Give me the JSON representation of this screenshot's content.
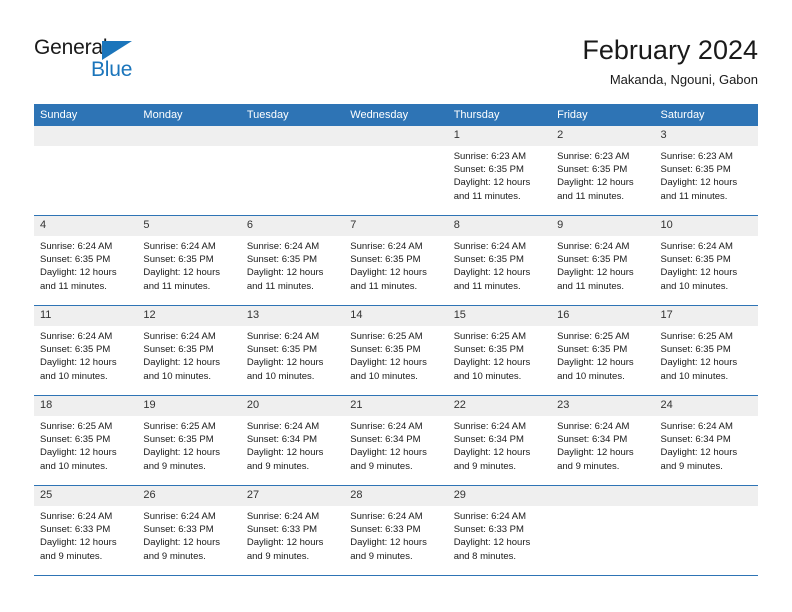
{
  "brand": {
    "name_part1": "General",
    "name_part2": "Blue"
  },
  "header": {
    "title": "February 2024",
    "subtitle": "Makanda, Ngouni, Gabon"
  },
  "colors": {
    "header_blue": "#2e74b5",
    "brand_blue": "#1b75bb",
    "daynum_band": "#efefef",
    "text": "#1a1a1a"
  },
  "weekdays": [
    "Sunday",
    "Monday",
    "Tuesday",
    "Wednesday",
    "Thursday",
    "Friday",
    "Saturday"
  ],
  "weeks": [
    [
      {
        "day": "",
        "sunrise": "",
        "sunset": "",
        "daylight1": "",
        "daylight2": ""
      },
      {
        "day": "",
        "sunrise": "",
        "sunset": "",
        "daylight1": "",
        "daylight2": ""
      },
      {
        "day": "",
        "sunrise": "",
        "sunset": "",
        "daylight1": "",
        "daylight2": ""
      },
      {
        "day": "",
        "sunrise": "",
        "sunset": "",
        "daylight1": "",
        "daylight2": ""
      },
      {
        "day": "1",
        "sunrise": "Sunrise: 6:23 AM",
        "sunset": "Sunset: 6:35 PM",
        "daylight1": "Daylight: 12 hours",
        "daylight2": "and 11 minutes."
      },
      {
        "day": "2",
        "sunrise": "Sunrise: 6:23 AM",
        "sunset": "Sunset: 6:35 PM",
        "daylight1": "Daylight: 12 hours",
        "daylight2": "and 11 minutes."
      },
      {
        "day": "3",
        "sunrise": "Sunrise: 6:23 AM",
        "sunset": "Sunset: 6:35 PM",
        "daylight1": "Daylight: 12 hours",
        "daylight2": "and 11 minutes."
      }
    ],
    [
      {
        "day": "4",
        "sunrise": "Sunrise: 6:24 AM",
        "sunset": "Sunset: 6:35 PM",
        "daylight1": "Daylight: 12 hours",
        "daylight2": "and 11 minutes."
      },
      {
        "day": "5",
        "sunrise": "Sunrise: 6:24 AM",
        "sunset": "Sunset: 6:35 PM",
        "daylight1": "Daylight: 12 hours",
        "daylight2": "and 11 minutes."
      },
      {
        "day": "6",
        "sunrise": "Sunrise: 6:24 AM",
        "sunset": "Sunset: 6:35 PM",
        "daylight1": "Daylight: 12 hours",
        "daylight2": "and 11 minutes."
      },
      {
        "day": "7",
        "sunrise": "Sunrise: 6:24 AM",
        "sunset": "Sunset: 6:35 PM",
        "daylight1": "Daylight: 12 hours",
        "daylight2": "and 11 minutes."
      },
      {
        "day": "8",
        "sunrise": "Sunrise: 6:24 AM",
        "sunset": "Sunset: 6:35 PM",
        "daylight1": "Daylight: 12 hours",
        "daylight2": "and 11 minutes."
      },
      {
        "day": "9",
        "sunrise": "Sunrise: 6:24 AM",
        "sunset": "Sunset: 6:35 PM",
        "daylight1": "Daylight: 12 hours",
        "daylight2": "and 11 minutes."
      },
      {
        "day": "10",
        "sunrise": "Sunrise: 6:24 AM",
        "sunset": "Sunset: 6:35 PM",
        "daylight1": "Daylight: 12 hours",
        "daylight2": "and 10 minutes."
      }
    ],
    [
      {
        "day": "11",
        "sunrise": "Sunrise: 6:24 AM",
        "sunset": "Sunset: 6:35 PM",
        "daylight1": "Daylight: 12 hours",
        "daylight2": "and 10 minutes."
      },
      {
        "day": "12",
        "sunrise": "Sunrise: 6:24 AM",
        "sunset": "Sunset: 6:35 PM",
        "daylight1": "Daylight: 12 hours",
        "daylight2": "and 10 minutes."
      },
      {
        "day": "13",
        "sunrise": "Sunrise: 6:24 AM",
        "sunset": "Sunset: 6:35 PM",
        "daylight1": "Daylight: 12 hours",
        "daylight2": "and 10 minutes."
      },
      {
        "day": "14",
        "sunrise": "Sunrise: 6:25 AM",
        "sunset": "Sunset: 6:35 PM",
        "daylight1": "Daylight: 12 hours",
        "daylight2": "and 10 minutes."
      },
      {
        "day": "15",
        "sunrise": "Sunrise: 6:25 AM",
        "sunset": "Sunset: 6:35 PM",
        "daylight1": "Daylight: 12 hours",
        "daylight2": "and 10 minutes."
      },
      {
        "day": "16",
        "sunrise": "Sunrise: 6:25 AM",
        "sunset": "Sunset: 6:35 PM",
        "daylight1": "Daylight: 12 hours",
        "daylight2": "and 10 minutes."
      },
      {
        "day": "17",
        "sunrise": "Sunrise: 6:25 AM",
        "sunset": "Sunset: 6:35 PM",
        "daylight1": "Daylight: 12 hours",
        "daylight2": "and 10 minutes."
      }
    ],
    [
      {
        "day": "18",
        "sunrise": "Sunrise: 6:25 AM",
        "sunset": "Sunset: 6:35 PM",
        "daylight1": "Daylight: 12 hours",
        "daylight2": "and 10 minutes."
      },
      {
        "day": "19",
        "sunrise": "Sunrise: 6:25 AM",
        "sunset": "Sunset: 6:35 PM",
        "daylight1": "Daylight: 12 hours",
        "daylight2": "and 9 minutes."
      },
      {
        "day": "20",
        "sunrise": "Sunrise: 6:24 AM",
        "sunset": "Sunset: 6:34 PM",
        "daylight1": "Daylight: 12 hours",
        "daylight2": "and 9 minutes."
      },
      {
        "day": "21",
        "sunrise": "Sunrise: 6:24 AM",
        "sunset": "Sunset: 6:34 PM",
        "daylight1": "Daylight: 12 hours",
        "daylight2": "and 9 minutes."
      },
      {
        "day": "22",
        "sunrise": "Sunrise: 6:24 AM",
        "sunset": "Sunset: 6:34 PM",
        "daylight1": "Daylight: 12 hours",
        "daylight2": "and 9 minutes."
      },
      {
        "day": "23",
        "sunrise": "Sunrise: 6:24 AM",
        "sunset": "Sunset: 6:34 PM",
        "daylight1": "Daylight: 12 hours",
        "daylight2": "and 9 minutes."
      },
      {
        "day": "24",
        "sunrise": "Sunrise: 6:24 AM",
        "sunset": "Sunset: 6:34 PM",
        "daylight1": "Daylight: 12 hours",
        "daylight2": "and 9 minutes."
      }
    ],
    [
      {
        "day": "25",
        "sunrise": "Sunrise: 6:24 AM",
        "sunset": "Sunset: 6:33 PM",
        "daylight1": "Daylight: 12 hours",
        "daylight2": "and 9 minutes."
      },
      {
        "day": "26",
        "sunrise": "Sunrise: 6:24 AM",
        "sunset": "Sunset: 6:33 PM",
        "daylight1": "Daylight: 12 hours",
        "daylight2": "and 9 minutes."
      },
      {
        "day": "27",
        "sunrise": "Sunrise: 6:24 AM",
        "sunset": "Sunset: 6:33 PM",
        "daylight1": "Daylight: 12 hours",
        "daylight2": "and 9 minutes."
      },
      {
        "day": "28",
        "sunrise": "Sunrise: 6:24 AM",
        "sunset": "Sunset: 6:33 PM",
        "daylight1": "Daylight: 12 hours",
        "daylight2": "and 9 minutes."
      },
      {
        "day": "29",
        "sunrise": "Sunrise: 6:24 AM",
        "sunset": "Sunset: 6:33 PM",
        "daylight1": "Daylight: 12 hours",
        "daylight2": "and 8 minutes."
      },
      {
        "day": "",
        "sunrise": "",
        "sunset": "",
        "daylight1": "",
        "daylight2": ""
      },
      {
        "day": "",
        "sunrise": "",
        "sunset": "",
        "daylight1": "",
        "daylight2": ""
      }
    ]
  ]
}
